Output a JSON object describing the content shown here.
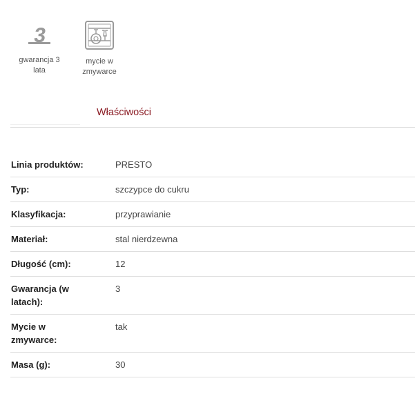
{
  "badges": [
    {
      "icon": "warranty-3-years-icon",
      "glyph": "3",
      "label_line1": "gwarancja 3",
      "label_line2": "lata"
    },
    {
      "icon": "dishwasher-safe-icon",
      "label_line1": "mycie w",
      "label_line2": "zmywarce"
    }
  ],
  "section": {
    "title": "Właściwości"
  },
  "properties": [
    {
      "key": "Linia produktów:",
      "value": "PRESTO"
    },
    {
      "key": "Typ:",
      "value": "szczypce do cukru"
    },
    {
      "key": "Klasyfikacja:",
      "value": "przyprawianie"
    },
    {
      "key": "Materiał:",
      "value": "stal nierdzewna"
    },
    {
      "key_line1": "Długość (cm):",
      "value": "12"
    },
    {
      "key_line1": "Gwarancja (w",
      "key_line2": "latach):",
      "value": "3"
    },
    {
      "key_line1": "Mycie w",
      "key_line2": "zmywarce:",
      "value": "tak"
    },
    {
      "key_line1": "Masa (g):",
      "value": "30"
    }
  ],
  "colors": {
    "accent": "#8b1c24",
    "icon_gray": "#9a9a9a",
    "rule": "#dedede"
  }
}
